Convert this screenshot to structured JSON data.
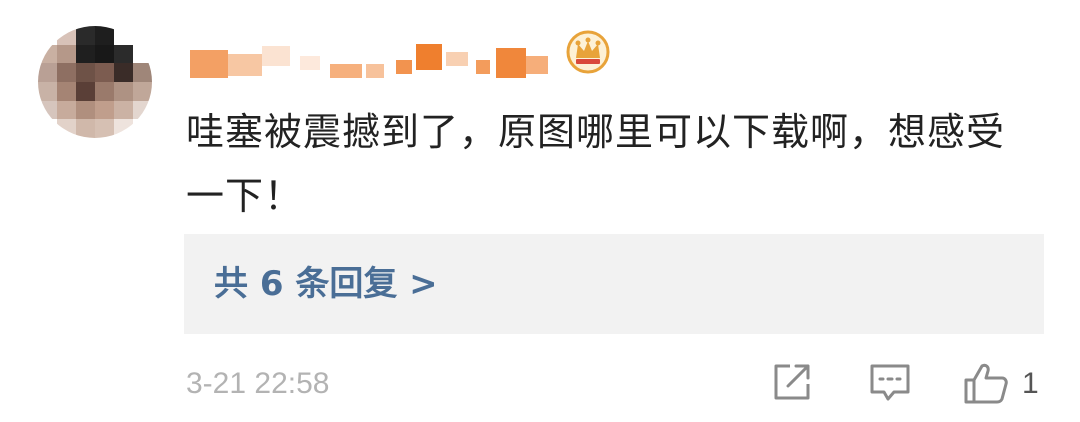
{
  "comment": {
    "text": "哇塞被震撼到了，原图哪里可以下载啊，想感受一下！",
    "timestamp": "3-21 22:58",
    "replies_link": "共 6 条回复 >",
    "like_count": "1"
  },
  "colors": {
    "reply_link": "#4a6e96",
    "reply_box_bg": "#f2f2f2",
    "timestamp": "#b3b3b3",
    "username_redacted": "#f28a3c",
    "crown_badge": "#e8a33a"
  },
  "icons": {
    "badge": "crown-badge-icon",
    "share": "share-icon",
    "comment": "comment-icon",
    "like": "thumbs-up-icon"
  }
}
